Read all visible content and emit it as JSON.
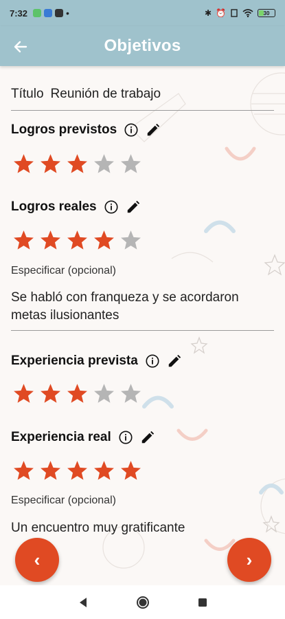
{
  "status_bar": {
    "time": "7:32",
    "battery_level": "30"
  },
  "app_bar": {
    "title": "Objetivos"
  },
  "form": {
    "title_label": "Título",
    "title_value": "Reunión de trabajo",
    "sections": [
      {
        "label": "Logros previstos",
        "rating": 3,
        "max": 5
      },
      {
        "label": "Logros reales",
        "rating": 4,
        "max": 5,
        "specify_label": "Especificar (opcional)",
        "note": "Se habló con franqueza y se acordaron metas ilusionantes"
      },
      {
        "label": "Experiencia prevista",
        "rating": 3,
        "max": 5
      },
      {
        "label": "Experiencia real",
        "rating": 5,
        "max": 5,
        "specify_label": "Especificar (opcional)",
        "note": "Un encuentro muy gratificante"
      }
    ]
  },
  "buttons": {
    "prev": "‹",
    "next": "›"
  },
  "colors": {
    "accent": "#e04a23",
    "header": "#9fc2cc",
    "star_off": "#b5b5b5"
  }
}
